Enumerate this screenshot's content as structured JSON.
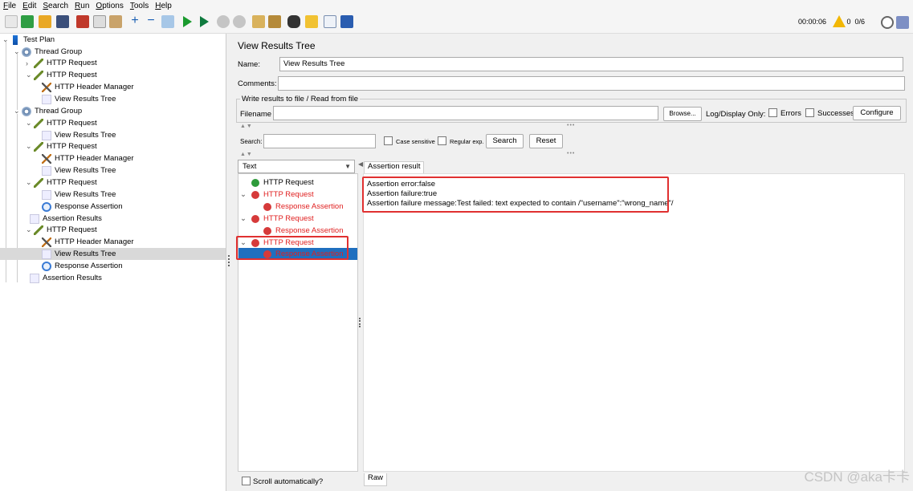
{
  "menu": [
    "File",
    "Edit",
    "Search",
    "Run",
    "Options",
    "Tools",
    "Help"
  ],
  "toolbar": {
    "timer": "00:00:06",
    "warnings": "0",
    "threads": "0/6"
  },
  "tree": {
    "nodes": [
      {
        "label": "Test Plan",
        "icon": "test-plan-icon"
      },
      {
        "label": "Thread Group",
        "icon": "thread-group-icon"
      },
      {
        "label": "HTTP Request",
        "icon": "http-request-icon"
      },
      {
        "label": "HTTP Request",
        "icon": "http-request-icon"
      },
      {
        "label": "HTTP Header Manager",
        "icon": "header-manager-icon"
      },
      {
        "label": "View Results Tree",
        "icon": "results-tree-icon"
      },
      {
        "label": "Thread Group",
        "icon": "thread-group-icon"
      },
      {
        "label": "HTTP Request",
        "icon": "http-request-icon"
      },
      {
        "label": "View Results Tree",
        "icon": "results-tree-icon"
      },
      {
        "label": "HTTP Request",
        "icon": "http-request-icon"
      },
      {
        "label": "HTTP Header Manager",
        "icon": "header-manager-icon"
      },
      {
        "label": "View Results Tree",
        "icon": "results-tree-icon"
      },
      {
        "label": "HTTP Request",
        "icon": "http-request-icon"
      },
      {
        "label": "View Results Tree",
        "icon": "results-tree-icon"
      },
      {
        "label": "Response Assertion",
        "icon": "response-assertion-icon"
      },
      {
        "label": "Assertion Results",
        "icon": "assertion-results-icon"
      },
      {
        "label": "HTTP Request",
        "icon": "http-request-icon"
      },
      {
        "label": "HTTP Header Manager",
        "icon": "header-manager-icon"
      },
      {
        "label": "View Results Tree",
        "icon": "results-tree-icon",
        "selected": true
      },
      {
        "label": "Response Assertion",
        "icon": "response-assertion-icon"
      },
      {
        "label": "Assertion Results",
        "icon": "assertion-results-icon"
      }
    ]
  },
  "panel": {
    "title": "View Results Tree",
    "name_label": "Name:",
    "name_value": "View Results Tree",
    "comments_label": "Comments:",
    "file_group_label": "Write results to file / Read from file",
    "filename_label": "Filename",
    "browse_label": "Browse...",
    "log_display_label": "Log/Display Only:",
    "errors_label": "Errors",
    "successes_label": "Successes",
    "configure_label": "Configure",
    "search_label": "Search:",
    "case_sensitive_label": "Case sensitive",
    "regular_exp_label": "Regular exp.",
    "search_button": "Search",
    "reset_button": "Reset",
    "renderer": "Text",
    "scroll_label": "Scroll automatically?"
  },
  "results": {
    "items": [
      {
        "label": "HTTP Request",
        "status": "ok"
      },
      {
        "label": "HTTP Request",
        "status": "fail"
      },
      {
        "label": "Response Assertion",
        "status": "fail"
      },
      {
        "label": "HTTP Request",
        "status": "fail"
      },
      {
        "label": "Response Assertion",
        "status": "fail"
      },
      {
        "label": "HTTP Request",
        "status": "fail"
      },
      {
        "label": "Response Assertion",
        "status": "fail",
        "selected": true
      }
    ],
    "tab_label": "Assertion result",
    "bottom_tab_label": "Raw",
    "lines": [
      "Assertion error:false",
      "Assertion failure:true",
      "Assertion failure message:Test failed: text expected to contain /\"username\":\"wrong_name\"/"
    ]
  },
  "watermark": "CSDN @aka卡卡",
  "colors": {
    "fail": "#e02020",
    "ok": "#2e9b3b",
    "selection": "#1f6fbf",
    "highlight_box": "#e03030"
  }
}
